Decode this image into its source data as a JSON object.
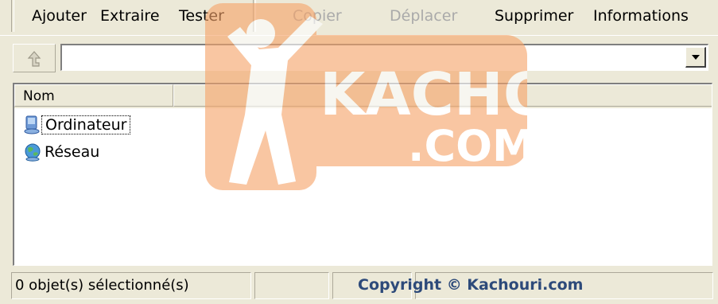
{
  "toolbar": {
    "items": [
      "Ajouter",
      "Extraire",
      "Tester",
      "Copier",
      "Déplacer",
      "Supprimer",
      "Informations"
    ]
  },
  "path": {
    "value": ""
  },
  "list": {
    "columns": [
      "Nom"
    ],
    "items": [
      {
        "label": "Ordinateur",
        "icon": "computer-icon",
        "focused": true
      },
      {
        "label": "Réseau",
        "icon": "network-icon",
        "focused": false
      }
    ]
  },
  "status": {
    "selection": "0 objet(s) sélectionné(s)",
    "copyright": "Copyright © Kachouri.com"
  },
  "watermark": {
    "text1": "KACHOURI",
    "text2": ".COM"
  },
  "colors": {
    "watermark_orange": "#f6a46a",
    "window_bg": "#ece9d8"
  }
}
